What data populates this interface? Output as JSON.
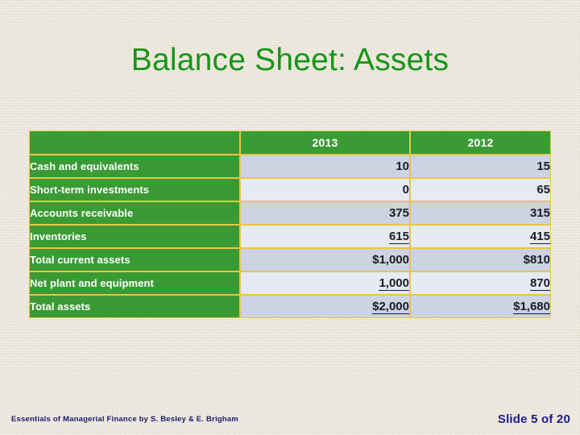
{
  "slide": {
    "title": "Balance Sheet: Assets",
    "title_color": "#179517",
    "background_color": "#ece5d9"
  },
  "table": {
    "header_bg": "#3a9b35",
    "border_color": "#e9c63f",
    "band_dark": "#ccd3e3",
    "band_light": "#e6eaf2",
    "columns": [
      "",
      "2013",
      "2012"
    ],
    "rows": [
      {
        "label": "Cash and equivalents",
        "y2013": "10",
        "y2012": "15",
        "underline": false,
        "band": "dark"
      },
      {
        "label": "Short-term investments",
        "y2013": "0",
        "y2012": "65",
        "underline": false,
        "band": "light"
      },
      {
        "label": "Accounts receivable",
        "y2013": "375",
        "y2012": "315",
        "underline": false,
        "band": "dark"
      },
      {
        "label": "Inventories",
        "y2013": "615",
        "y2012": "415",
        "underline": true,
        "band": "light"
      },
      {
        "label": "Total current assets",
        "y2013": "$1,000",
        "y2012": "$810",
        "underline": false,
        "band": "dark"
      },
      {
        "label": "Net plant and equipment",
        "y2013": "1,000",
        "y2012": "870",
        "underline": true,
        "band": "light"
      },
      {
        "label": "Total assets",
        "y2013": "$2,000",
        "y2012": "$1,680",
        "underline": true,
        "band": "dark"
      }
    ]
  },
  "footer": {
    "credit": "Essentials of Managerial Finance by S. Besley & E. Brigham",
    "slide_number": "Slide 5 of 20",
    "text_color": "#1b1b8c"
  }
}
